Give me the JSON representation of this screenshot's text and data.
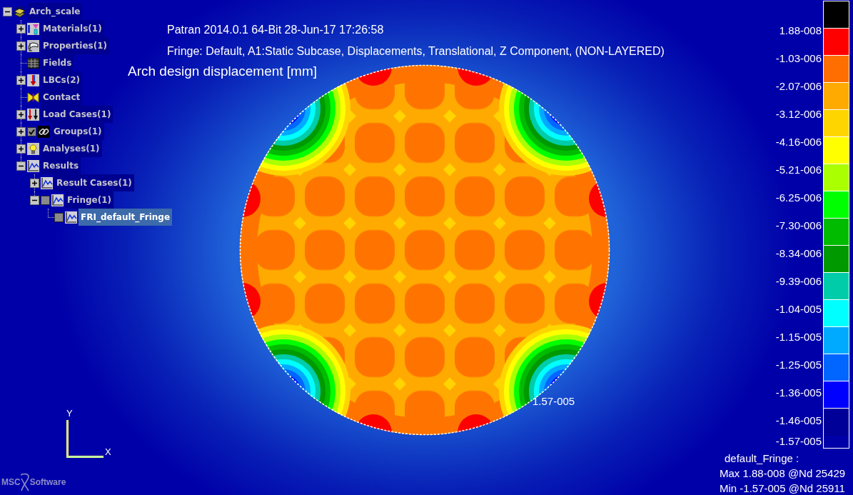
{
  "model_tree": {
    "items": [
      {
        "label": "Arch_scale",
        "kind": "model",
        "expanded": true,
        "selected": false,
        "children": [
          {
            "label": "Materials(1)",
            "kind": "material",
            "expanded": false,
            "selected": false
          },
          {
            "label": "Properties(1)",
            "kind": "property",
            "expanded": false,
            "selected": false
          },
          {
            "label": "Fields",
            "kind": "field",
            "selected": false
          },
          {
            "label": "LBCs(2)",
            "kind": "lbc",
            "expanded": false,
            "selected": false
          },
          {
            "label": "Contact",
            "kind": "contact",
            "selected": false
          },
          {
            "label": "Load Cases(1)",
            "kind": "loadcase",
            "expanded": false,
            "selected": false
          },
          {
            "label": "Groups(1)",
            "kind": "group",
            "expanded": false,
            "checked": true,
            "selected": false
          },
          {
            "label": "Analyses(1)",
            "kind": "analysis",
            "expanded": false,
            "selected": false
          },
          {
            "label": "Results",
            "kind": "result",
            "expanded": true,
            "selected": false,
            "children": [
              {
                "label": "Result Cases(1)",
                "kind": "result",
                "expanded": false,
                "selected": false
              },
              {
                "label": "Fringe(1)",
                "kind": "result",
                "expanded": true,
                "checked": false,
                "selected": false,
                "children": [
                  {
                    "label": "FRI_default_Fringe",
                    "kind": "result",
                    "checked": false,
                    "selected": true
                  }
                ]
              }
            ]
          }
        ]
      }
    ]
  },
  "viewport": {
    "header_lines": [
      "Patran 2014.0.1 64-Bit 28-Jun-17 17:26:58",
      "Fringe: Default, A1:Static Subcase, Displacements, Translational, Z Component, (NON-LAYERED)"
    ],
    "plot_title": "Arch design displacement [mm]",
    "min_marker_label": "1.57-005",
    "axis_labels": {
      "y": "Y",
      "x": "X"
    },
    "logo": {
      "left": "MSC",
      "right": "Software"
    }
  },
  "legend": {
    "entries": [
      {
        "color": "#000000"
      },
      {
        "label": "1.88-008",
        "color": "#ff0000"
      },
      {
        "label": "-1.03-006",
        "color": "#ff6e00"
      },
      {
        "label": "-2.07-006",
        "color": "#ffaa00"
      },
      {
        "label": "-3.12-006",
        "color": "#ffd500"
      },
      {
        "label": "-4.16-006",
        "color": "#ffff00"
      },
      {
        "label": "-5.21-006",
        "color": "#aaff00"
      },
      {
        "label": "-6.25-006",
        "color": "#00ff00"
      },
      {
        "label": "-7.30-006",
        "color": "#00bb00"
      },
      {
        "label": "-8.34-006",
        "color": "#009900"
      },
      {
        "label": "-9.39-006",
        "color": "#00ccaa"
      },
      {
        "label": "-1.04-005",
        "color": "#00ffff"
      },
      {
        "label": "-1.15-005",
        "color": "#00aaff"
      },
      {
        "label": "-1.25-005",
        "color": "#0066ff"
      },
      {
        "label": "-1.36-005",
        "color": "#0000ff"
      },
      {
        "label": "-1.46-005",
        "color": "#000099"
      }
    ],
    "end_label": "-1.57-005",
    "summary": {
      "title": "default_Fringe :",
      "lines": [
        "Max 1.88-008 @Nd 25429",
        "Min -1.57-005 @Nd 25911"
      ]
    }
  }
}
